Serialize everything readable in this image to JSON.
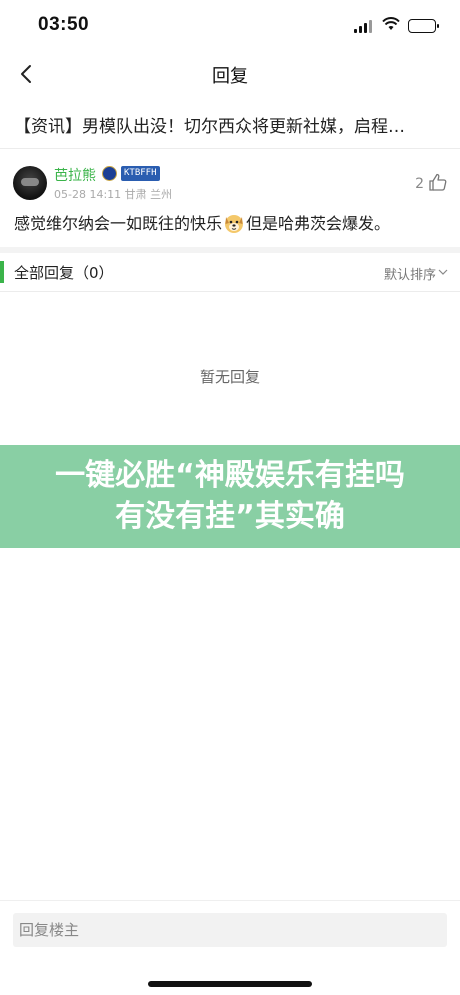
{
  "status_bar": {
    "time": "03:50",
    "icons": [
      "signal-icon",
      "wifi-icon",
      "battery-icon"
    ]
  },
  "nav": {
    "title": "回复",
    "back_icon": "chevron-left-icon"
  },
  "article": {
    "title": "【资讯】男模队出没！切尔西众将更新社媒，启程…"
  },
  "comment": {
    "user_name": "芭拉熊",
    "badge_text": "KTBFFH",
    "meta": "05-28 14:11 甘肃 兰州",
    "like_count": "2",
    "text_before": "感觉维尔纳会一如既往的快乐",
    "text_after": "但是哈弗茨会爆发。",
    "emoji": "dog-face-emoji"
  },
  "replies": {
    "title": "全部回复（0）",
    "sort_label": "默认排序",
    "empty_text": "暂无回复"
  },
  "banner": {
    "text": "一键必胜“神殿娱乐有挂吗有没有挂”其实确"
  },
  "bottom": {
    "reply_placeholder": "回复楼主"
  },
  "colors": {
    "accent_green": "#3bb44a",
    "banner_bg": "#89cfa4"
  }
}
